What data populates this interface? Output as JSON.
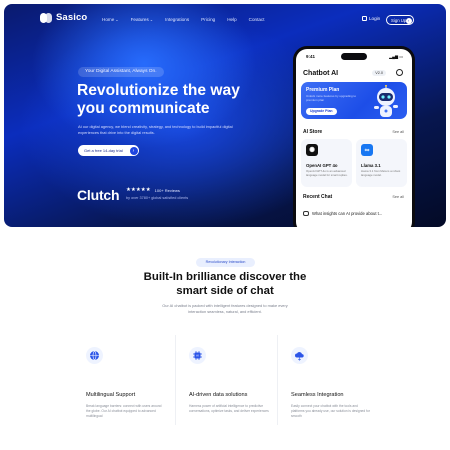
{
  "brand": {
    "name": "Sasico"
  },
  "nav": {
    "links": [
      {
        "label": "Home",
        "has_chevron": true
      },
      {
        "label": "Features",
        "has_chevron": true
      },
      {
        "label": "Integrations",
        "has_chevron": false
      },
      {
        "label": "Pricing",
        "has_chevron": false
      },
      {
        "label": "Help",
        "has_chevron": false
      },
      {
        "label": "Contact",
        "has_chevron": false
      }
    ],
    "login_label": "Login",
    "signup_label": "Sign Up"
  },
  "hero": {
    "tagline": "Your Digital Assistant, Always On.",
    "title_line1": "Revolutionize the way",
    "title_line2": "you communicate",
    "subtitle": "At our digital agency, we blend creativity, strategy, and technology to build impactful digital experiences that drive into the digital results.",
    "cta_label": "Get a free 14-day trial",
    "clutch_label": "Clutch",
    "stars": "★★★★★",
    "reviews": "100+ Reviews",
    "trust_text": "by over 3780+ global satisfied clients"
  },
  "phone": {
    "time": "9:41",
    "app_title": "Chatbot AI",
    "version_badge": "V2.0",
    "premium_title": "Premium Plan",
    "premium_desc": "Unlock more features by upgrading to premium plan",
    "upgrade_label": "Upgrade Plan",
    "ai_store_label": "AI Store",
    "see_all_label": "See all",
    "cards": [
      {
        "name": "OpenAI GPT 4o",
        "desc": "OpenAI GPT-4o is an advanced language model for smart replies.",
        "icon": "openai-icon"
      },
      {
        "name": "Llama 3.1",
        "desc": "Llama 3.1 from Meta is a robust language model.",
        "icon": "meta-icon"
      }
    ],
    "recent_chat_label": "Recent Chat",
    "recent_chat_see_all": "See all",
    "recent_item": "What insights can AI provide about t..."
  },
  "section2": {
    "pill": "Revolutionary Interaction",
    "title_line1": "Built-In brilliance discover the",
    "title_line2": "smart side of chat",
    "description": "Our AI chatbot is packed with intelligent features designed to make every interaction seamless, natural, and efficient.",
    "features": [
      {
        "title": "Multilingual Support",
        "desc": "Break language barriers: connect with users around the globe. Our AI chatbot equipped to advanced multilingual",
        "icon": "globe-chat-icon"
      },
      {
        "title": "AI-driven data solutions",
        "desc": "Harness power of artificial intelligence to predictive conversations, optimize tasks, and deliver experiences",
        "icon": "ai-chip-icon"
      },
      {
        "title": "Seamless Integration",
        "desc": "Easily connect your chatbot with the tools and platforms you already use, our solution is designed for smooth",
        "icon": "cloud-sync-icon"
      }
    ]
  },
  "colors": {
    "accent": "#1e45e0",
    "hero_dark": "#07164f",
    "pill_bg": "#e9effe"
  }
}
